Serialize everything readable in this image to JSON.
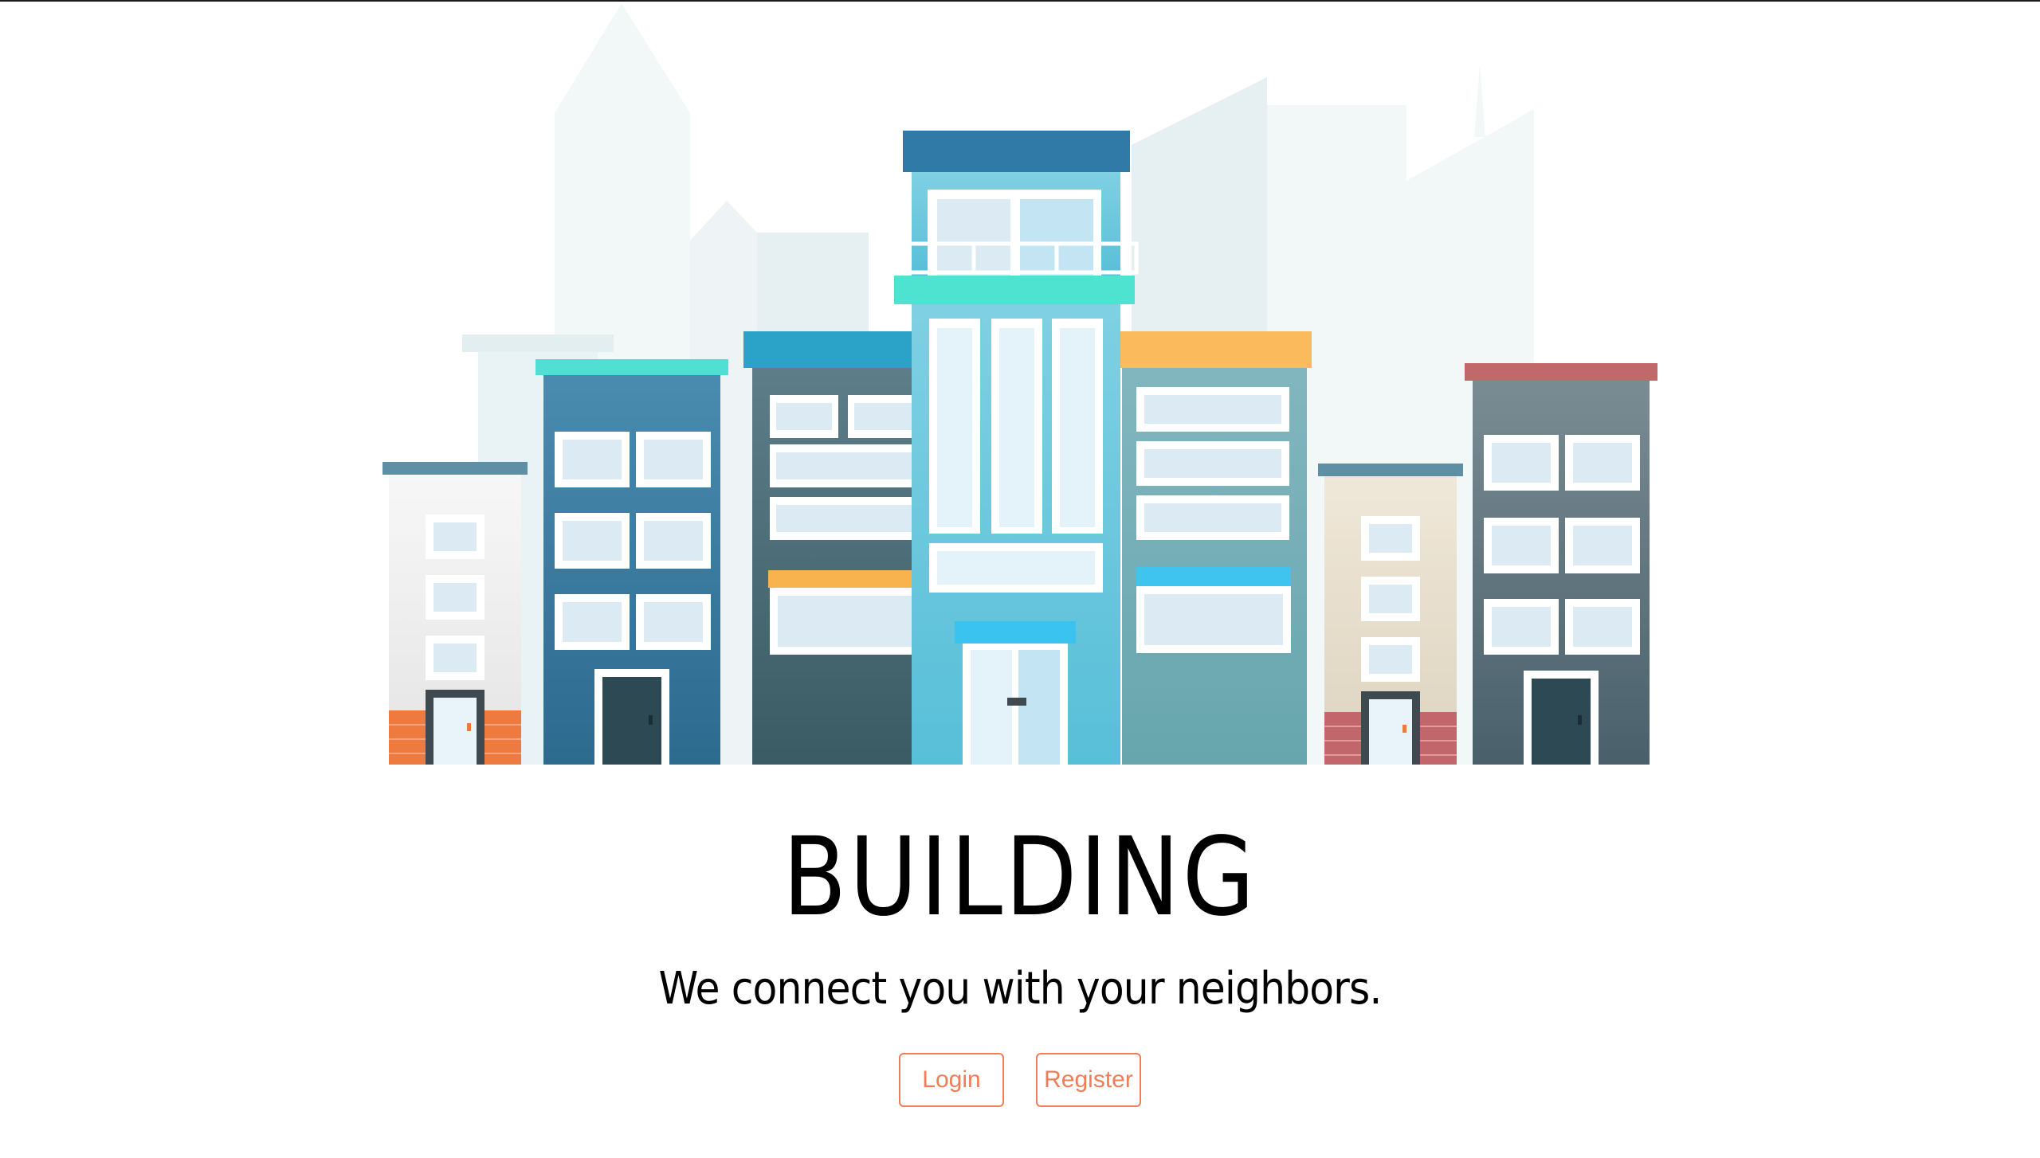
{
  "brand": {
    "title": "BUILDING",
    "tagline": "We connect you with your neighbors."
  },
  "actions": {
    "login_label": "Login",
    "register_label": "Register"
  },
  "colors": {
    "accent": "#ef7e58",
    "text": "#000000",
    "background": "#ffffff"
  },
  "illustration": {
    "icon": "city-buildings-illustration"
  }
}
